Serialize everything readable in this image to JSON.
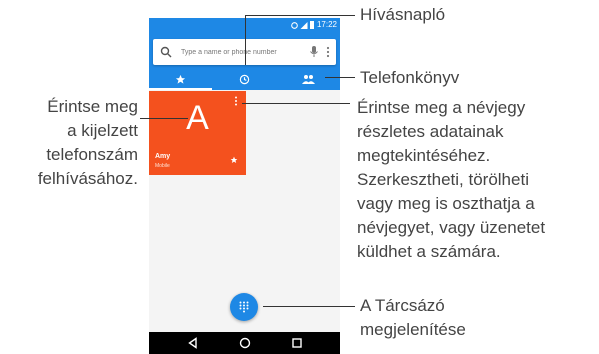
{
  "statusbar": {
    "time": "17:22"
  },
  "search": {
    "placeholder": "Type a name or phone number"
  },
  "contact": {
    "initial": "A",
    "name": "Amy",
    "type": "Mobile"
  },
  "callouts": {
    "call_log": "Hívásnapló",
    "contacts": "Telefonkönyv",
    "left": "Érintse meg\na kijelzett\ntelefonszám\nfelhívásához.",
    "right": "Érintse meg a névjegy\nrészletes adatainak\nmegtekintéséhez.\nSzerkesztheti, törölheti\nvagy meg is oszthatja a\nnévjegyet, vagy üzenetet\nküldhet a számára.",
    "dialpad_line1": "A Tárcsázó",
    "dialpad_line2": "megjelenítése"
  },
  "colors": {
    "accent": "#1e88e5",
    "card": "#f4511e"
  },
  "icons": {
    "tab1": "star-icon",
    "tab2": "clock-icon",
    "tab3": "people-icon",
    "fab": "dialpad-icon"
  }
}
